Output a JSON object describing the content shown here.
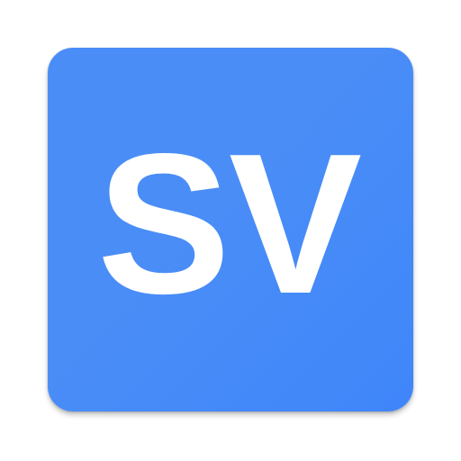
{
  "icon": {
    "text": "SV",
    "background_color": "#4a8df7",
    "text_color": "#ffffff"
  }
}
